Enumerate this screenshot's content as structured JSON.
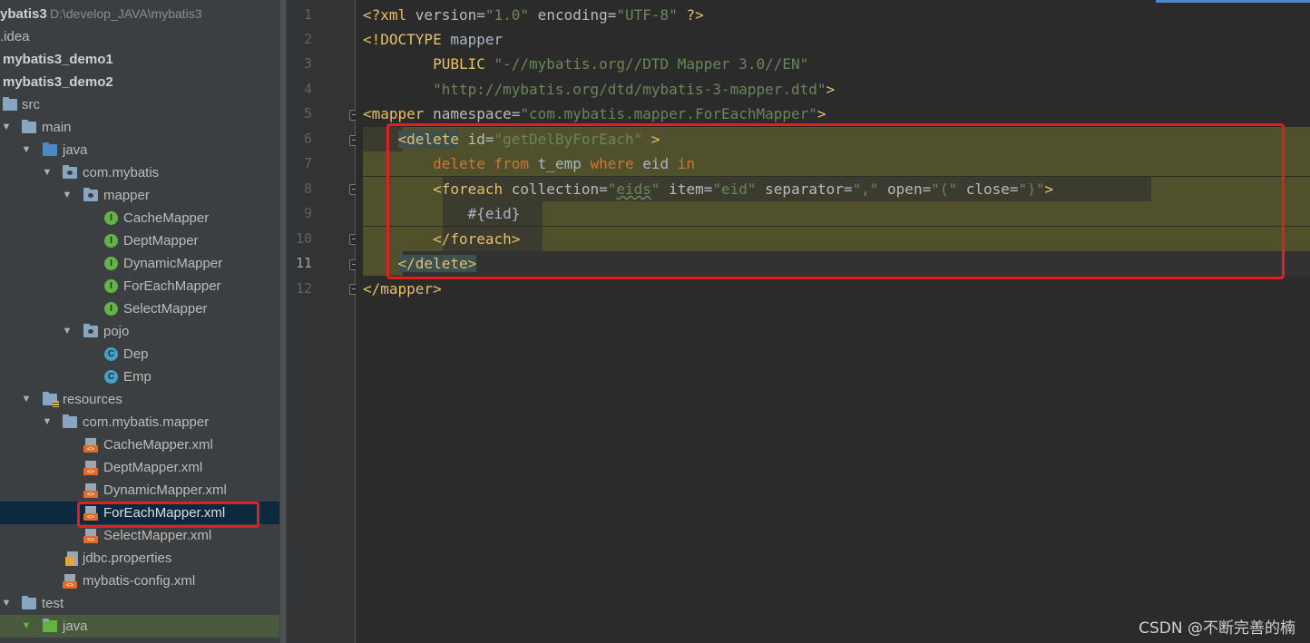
{
  "project": {
    "root_name": "ybatis3",
    "root_path": "D:\\develop_JAVA\\mybatis3"
  },
  "tree": {
    "idea": ".idea",
    "demo1": "mybatis3_demo1",
    "demo2": "mybatis3_demo2",
    "src": "src",
    "main": "main",
    "java": "java",
    "pkg": "com.mybatis",
    "mapper": "mapper",
    "mapper_items": [
      "CacheMapper",
      "DeptMapper",
      "DynamicMapper",
      "ForEachMapper",
      "SelectMapper"
    ],
    "pojo": "pojo",
    "pojo_items": [
      "Dep",
      "Emp"
    ],
    "resources": "resources",
    "res_pkg": "com.mybatis.mapper",
    "xml_items": [
      "CacheMapper.xml",
      "DeptMapper.xml",
      "DynamicMapper.xml",
      "ForEachMapper.xml",
      "SelectMapper.xml"
    ],
    "jdbc": "jdbc.properties",
    "config": "mybatis-config.xml",
    "test": "test",
    "test_java": "java",
    "selected": "ForEachMapper.xml"
  },
  "editor": {
    "line_numbers": [
      "1",
      "2",
      "3",
      "4",
      "5",
      "6",
      "7",
      "8",
      "9",
      "10",
      "11",
      "12"
    ],
    "current_line": "11",
    "l1": {
      "a": "<?xml ",
      "b": "version",
      "c": "=",
      "d": "\"1.0\"",
      "e": " encoding",
      "f": "=",
      "g": "\"UTF-8\"",
      "h": " ?>"
    },
    "l2": {
      "a": "<!DOCTYPE ",
      "b": "mapper"
    },
    "l3": {
      "a": "        PUBLIC ",
      "b": "\"-//mybatis.org//DTD Mapper 3.0//EN\""
    },
    "l4": {
      "a": "        ",
      "b": "\"http://mybatis.org/dtd/mybatis-3-mapper.dtd\"",
      "c": ">"
    },
    "l5": {
      "a": "<mapper ",
      "b": "namespace",
      "c": "=",
      "d": "\"com.mybatis.mapper.ForEachMapper\"",
      "e": ">"
    },
    "l6": {
      "a": "    ",
      "b": "<delete",
      "c": " id",
      "d": "=",
      "e": "\"getDelByForEach\"",
      "f": " >"
    },
    "l7": {
      "a": "        ",
      "b": "delete ",
      "c": "from ",
      "d": "t_emp ",
      "e": "where ",
      "f": "eid ",
      "g": "in"
    },
    "l8": {
      "a": "        ",
      "b": "<foreach ",
      "c": "collection",
      "d": "=",
      "e": "\"",
      "f": "eids",
      "g": "\"",
      "h": " item",
      "i": "=",
      "j": "\"eid\"",
      "k": " separator",
      "l": "=",
      "m": "\",\"",
      "n": " open",
      "o": "=",
      "p": "\"(\"",
      "q": " close",
      "r": "=",
      "s": "\")\"",
      "t": ">"
    },
    "l9": {
      "a": "            ",
      "b": "#{eid}"
    },
    "l10": {
      "a": "        ",
      "b": "</foreach>"
    },
    "l11": {
      "a": "    ",
      "b": "</delete>"
    },
    "l12": {
      "a": "</mapper>"
    }
  },
  "watermark": "CSDN @不断完善的楠",
  "colors": {
    "tag": "#e8bf6a",
    "value": "#6a8759",
    "keyword": "#cc7832",
    "highlight_border": "#e02020",
    "selection": "#0d293e"
  }
}
